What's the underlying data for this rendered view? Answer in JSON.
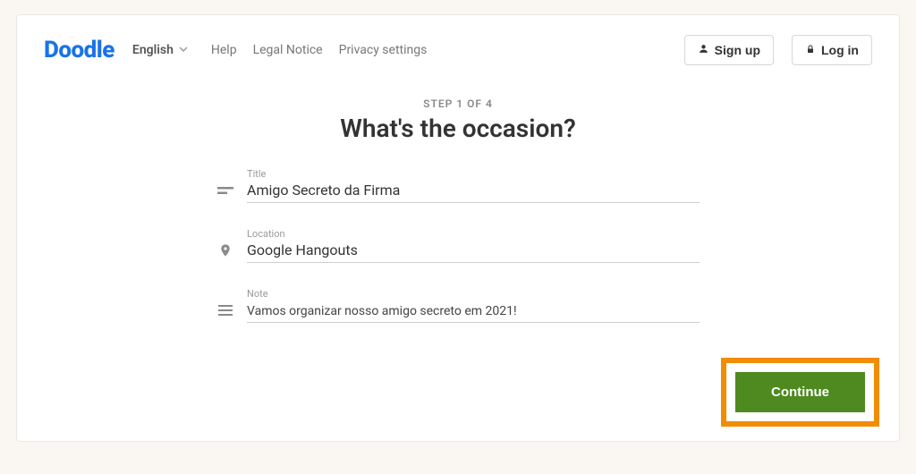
{
  "logo": "Doodle",
  "language": {
    "label": "English"
  },
  "nav": {
    "help": "Help",
    "legal": "Legal Notice",
    "privacy": "Privacy settings"
  },
  "auth": {
    "signup": "Sign up",
    "login": "Log in"
  },
  "step": "STEP 1 OF 4",
  "heading": "What's the occasion?",
  "fields": {
    "title": {
      "label": "Title",
      "value": "Amigo Secreto da Firma"
    },
    "location": {
      "label": "Location",
      "value": "Google Hangouts"
    },
    "note": {
      "label": "Note",
      "value": "Vamos organizar nosso amigo secreto em 2021!"
    }
  },
  "continue": "Continue"
}
